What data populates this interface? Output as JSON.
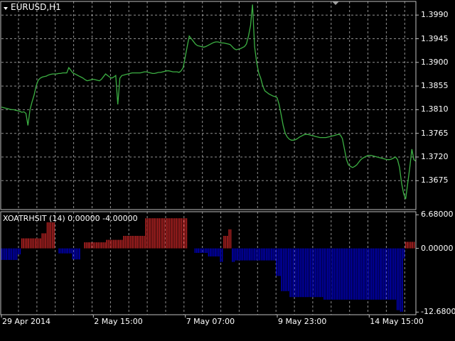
{
  "window": {
    "symbol_label": "EURUSD,H1",
    "indicator_label": "XOATRHSIT (14) 0.00000 -4.00000"
  },
  "colors": {
    "background": "#000000",
    "grid": "#c0c0c0",
    "frame": "#c0c0c0",
    "price_line": "#3cb043",
    "hist_positive": "#b22222",
    "hist_negative": "#0000b4",
    "text": "#ffffff"
  },
  "icons": [
    "collapse-triangle-icon",
    "scroll-marker-icon"
  ],
  "chart_data": [
    {
      "type": "line",
      "title": "EURUSD,H1",
      "ylim": [
        1.362,
        1.4016
      ],
      "y_ticks": [
        "1.3990",
        "1.3945",
        "1.3900",
        "1.3855",
        "1.3810",
        "1.3765",
        "1.3720",
        "1.3675"
      ],
      "grid": true,
      "series": [
        {
          "values": [
            1.3815,
            1.3814,
            1.3813,
            1.3812,
            1.3811,
            1.381,
            1.381,
            1.3809,
            1.3808,
            1.3807,
            1.3805,
            1.3806,
            1.3803,
            1.378,
            1.381,
            1.3825,
            1.3838,
            1.3855,
            1.3866,
            1.387,
            1.3872,
            1.3873,
            1.3874,
            1.3876,
            1.3877,
            1.3878,
            1.3878,
            1.3878,
            1.3879,
            1.3879,
            1.388,
            1.388,
            1.388,
            1.389,
            1.3885,
            1.388,
            1.3878,
            1.3876,
            1.3874,
            1.3872,
            1.387,
            1.3867,
            1.3865,
            1.3866,
            1.3867,
            1.3868,
            1.3867,
            1.3866,
            1.3865,
            1.3868,
            1.3873,
            1.3878,
            1.3875,
            1.3872,
            1.387,
            1.3872,
            1.3875,
            1.382,
            1.387,
            1.3875,
            1.3876,
            1.3877,
            1.3878,
            1.3879,
            1.388,
            1.388,
            1.388,
            1.388,
            1.388,
            1.3881,
            1.3882,
            1.3882,
            1.3881,
            1.388,
            1.3879,
            1.3879,
            1.388,
            1.3881,
            1.3881,
            1.3882,
            1.3883,
            1.3884,
            1.3884,
            1.3883,
            1.3882,
            1.3882,
            1.3882,
            1.3881,
            1.3884,
            1.389,
            1.391,
            1.393,
            1.395,
            1.3945,
            1.394,
            1.3935,
            1.3932,
            1.3931,
            1.393,
            1.3929,
            1.393,
            1.3932,
            1.3934,
            1.3936,
            1.3938,
            1.3939,
            1.3939,
            1.3938,
            1.3937,
            1.3937,
            1.3936,
            1.3935,
            1.3934,
            1.393,
            1.3926,
            1.3924,
            1.3925,
            1.3926,
            1.3928,
            1.393,
            1.3935,
            1.395,
            1.397,
            1.401,
            1.393,
            1.39,
            1.388,
            1.387,
            1.3855,
            1.3846,
            1.3843,
            1.384,
            1.3838,
            1.3836,
            1.3835,
            1.3833,
            1.382,
            1.38,
            1.378,
            1.3765,
            1.3758,
            1.3754,
            1.3752,
            1.3752,
            1.3753,
            1.3755,
            1.3758,
            1.376,
            1.3762,
            1.3763,
            1.3763,
            1.3762,
            1.3761,
            1.376,
            1.3759,
            1.3758,
            1.3757,
            1.3757,
            1.3757,
            1.3757,
            1.3758,
            1.3759,
            1.376,
            1.3761,
            1.3762,
            1.3763,
            1.3762,
            1.3755,
            1.3735,
            1.3715,
            1.3705,
            1.3702,
            1.37,
            1.3702,
            1.3705,
            1.371,
            1.3715,
            1.3718,
            1.372,
            1.3722,
            1.3723,
            1.3723,
            1.3722,
            1.3721,
            1.372,
            1.3719,
            1.3718,
            1.3717,
            1.3716,
            1.3715,
            1.3715,
            1.3716,
            1.3718,
            1.372,
            1.3715,
            1.37,
            1.367,
            1.365,
            1.364,
            1.367,
            1.37,
            1.3735,
            1.3715,
            1.3712
          ]
        }
      ]
    },
    {
      "type": "bar",
      "title": "XOATRHSIT (14) 0.00000 -4.00000",
      "ylim": [
        -13.2,
        7.3
      ],
      "y_ticks": [
        "6.68000",
        "0.00000",
        "-12.6800"
      ],
      "segments": [
        {
          "count": 10,
          "value": -2.3
        },
        {
          "count": 2,
          "value": -1.2
        },
        {
          "count": 12,
          "value": 2.0
        },
        {
          "count": 3,
          "value": 3.0
        },
        {
          "count": 5,
          "value": 5.2
        },
        {
          "count": 2,
          "value": 0.0
        },
        {
          "count": 8,
          "value": -1.0
        },
        {
          "count": 5,
          "value": -2.2
        },
        {
          "count": 2,
          "value": 0.0
        },
        {
          "count": 13,
          "value": 1.2
        },
        {
          "count": 10,
          "value": 1.7
        },
        {
          "count": 13,
          "value": 2.5
        },
        {
          "count": 25,
          "value": 6.0
        },
        {
          "count": 4,
          "value": 0.0
        },
        {
          "count": 8,
          "value": -0.9
        },
        {
          "count": 7,
          "value": -1.6
        },
        {
          "count": 2,
          "value": -2.7
        },
        {
          "count": 3,
          "value": 2.5
        },
        {
          "count": 2,
          "value": 3.8
        },
        {
          "count": 2,
          "value": -2.7
        },
        {
          "count": 24,
          "value": -2.4
        },
        {
          "count": 3,
          "value": -5.5
        },
        {
          "count": 5,
          "value": -8.5
        },
        {
          "count": 20,
          "value": -9.7
        },
        {
          "count": 43,
          "value": -10.2
        },
        {
          "count": 2,
          "value": -12.3
        },
        {
          "count": 2,
          "value": -12.6
        },
        {
          "count": 1,
          "value": -2.0
        },
        {
          "count": 6,
          "value": 1.3
        }
      ]
    }
  ],
  "x_axis": {
    "labels": [
      "29 Apr 2014",
      "2 May 15:00",
      "7 May 07:00",
      "9 May 23:00",
      "14 May 15:00"
    ],
    "label_positions": [
      0,
      129.3,
      258.7,
      388.0,
      517.3
    ]
  }
}
